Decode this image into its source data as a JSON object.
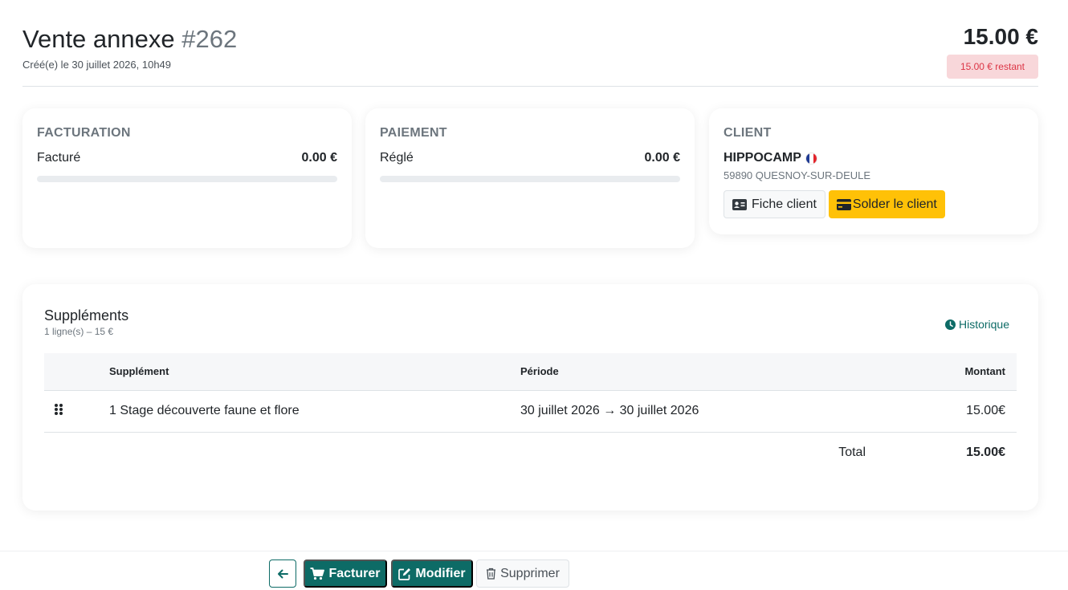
{
  "header": {
    "title": "Vente annexe",
    "number": "#262",
    "created": "Créé(e) le 30 juillet 2026, 10h49",
    "total": "15.00 €",
    "remaining": "15.00 € restant"
  },
  "facturation": {
    "title": "FACTURATION",
    "label": "Facturé",
    "value": "0.00 €",
    "progress": 0
  },
  "paiement": {
    "title": "PAIEMENT",
    "label": "Réglé",
    "value": "0.00 €",
    "progress": 0
  },
  "client": {
    "title": "CLIENT",
    "name": "HIPPOCAMP",
    "flag_icon": "flag-france-icon",
    "address": "59890 QUESNOY-SUR-DEULE",
    "fiche_label": "Fiche client",
    "solder_label": "Solder le client"
  },
  "supplements": {
    "title": "Suppléments",
    "subtitle": "1 ligne(s) – 15 €",
    "historique_label": "Historique",
    "columns": [
      "Supplément",
      "Période",
      "Montant"
    ],
    "rows": [
      {
        "name": "1 Stage découverte faune et flore",
        "period": "30 juillet 2026 → 30 juillet 2026",
        "amount": "15.00€"
      }
    ],
    "total_label": "Total",
    "total_value": "15.00€"
  },
  "footer": {
    "facturer_label": "Facturer",
    "modifier_label": "Modifier",
    "supprimer_label": "Supprimer"
  },
  "colors": {
    "primary": "#0d6b66",
    "warning": "#ffc107",
    "danger_bg": "#f8d7da",
    "danger_text": "#dc3545"
  }
}
